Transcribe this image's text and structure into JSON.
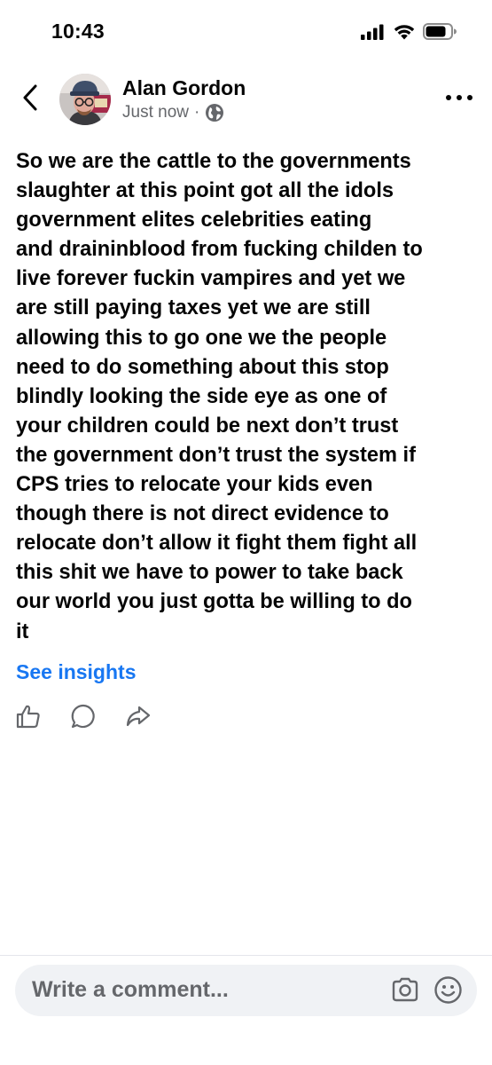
{
  "status_bar": {
    "time": "10:43",
    "icons": [
      "cellular-signal-icon",
      "wifi-icon",
      "battery-icon"
    ]
  },
  "post": {
    "author_name": "Alan Gordon",
    "timestamp": "Just now",
    "separator": "·",
    "audience_icon": "globe-icon",
    "text": "So we are the cattle to the governments\nslaughter at this point got all the idols\ngovernment elites celebrities  eating\nand draininblood from fucking childen to\nlive forever fuckin vampires and yet we\nare still paying taxes yet we are still\nallowing this to go one we the people\nneed to do something about this stop\nblindly looking the side eye as one of\nyour children could be next don’t trust\nthe government don’t trust the system if\nCPS tries to relocate your kids even\nthough there is not direct evidence to\nrelocate don’t allow it fight them fight all\nthis shit we have to power to take back\nour world you just gotta be willing to do\nit",
    "insights_label": "See insights"
  },
  "actions": [
    "like-icon",
    "comment-icon",
    "share-icon"
  ],
  "comment_bar": {
    "placeholder": "Write a comment...",
    "icons": [
      "camera-icon",
      "emoji-icon"
    ]
  },
  "colors": {
    "link_blue": "#1877f2",
    "text_primary": "#050505",
    "text_secondary": "#65676b",
    "input_bg": "#f0f2f5"
  }
}
